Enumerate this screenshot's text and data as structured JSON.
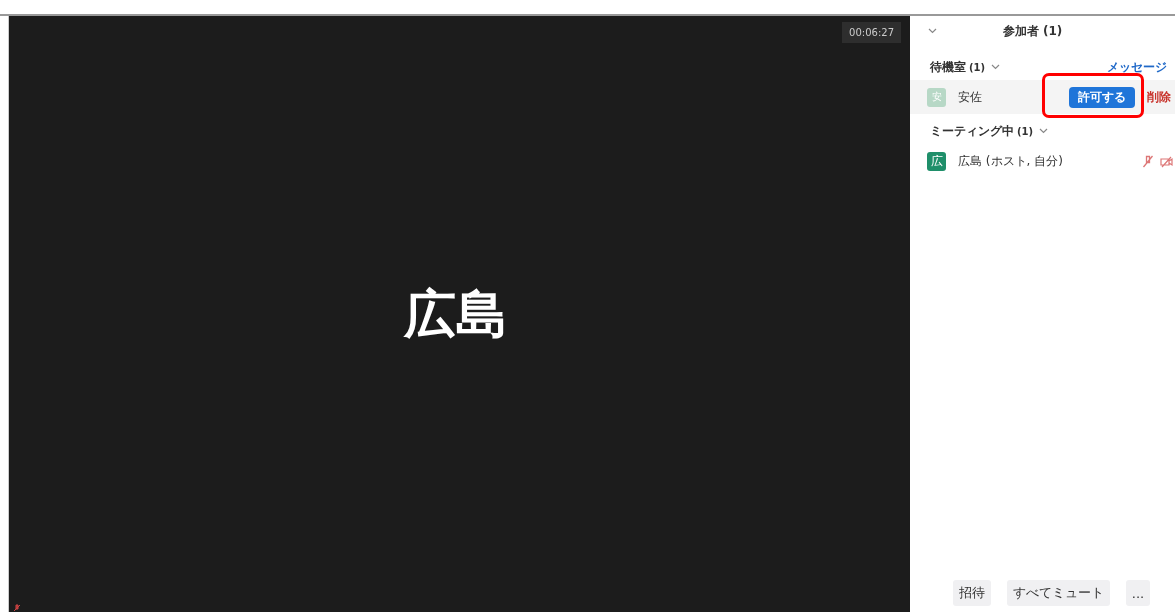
{
  "video": {
    "timer": "00:06:27",
    "name": "広島"
  },
  "panel": {
    "title": "参加者 (1)",
    "waiting_room": {
      "title": "待機室",
      "count": "(1)",
      "message_link": "メッセージ",
      "participants": [
        {
          "avatar": "安",
          "name": "安佐",
          "admit_button": "許可する",
          "remove_button": "削除",
          "highlighted": true
        }
      ]
    },
    "in_meeting": {
      "title": "ミーティング中",
      "count": "(1)",
      "participants": [
        {
          "avatar": "広",
          "name": "広島",
          "role": "(ホスト, 自分)",
          "muted": true,
          "video_off": true
        }
      ]
    },
    "buttons": [
      "招待",
      "すべてミュート",
      "..."
    ]
  }
}
